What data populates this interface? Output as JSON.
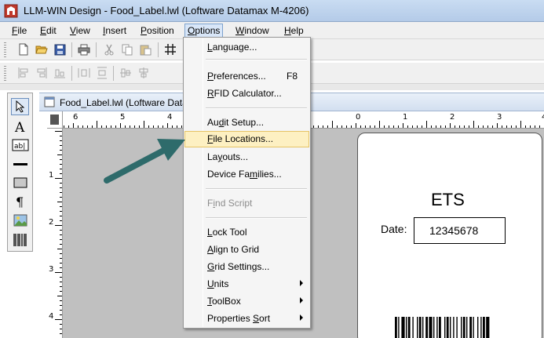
{
  "window": {
    "title": "LLM-WIN Design - Food_Label.lwl (Loftware Datamax M-4206)"
  },
  "menubar": {
    "items": [
      "File",
      "Edit",
      "View",
      "Insert",
      "Position",
      "Options",
      "Window",
      "Help"
    ],
    "active": "Options"
  },
  "document": {
    "title": "Food_Label.lwl (Loftware Data"
  },
  "ruler": {
    "horizontal": [
      "6",
      "5",
      "4",
      "0",
      "1",
      "2",
      "3",
      "4"
    ],
    "vertical": [
      "1",
      "2",
      "3",
      "4"
    ]
  },
  "options_menu": {
    "items": [
      {
        "label": "Language...",
        "mnemonic": "L"
      },
      {
        "label": "Preferences...",
        "mnemonic": "P",
        "shortcut": "F8"
      },
      {
        "label": "RFID Calculator...",
        "mnemonic": "R"
      },
      {
        "label": "Audit Setup...",
        "mnemonic": "d"
      },
      {
        "label": "File Locations...",
        "mnemonic": "F",
        "highlighted": true
      },
      {
        "label": "Layouts...",
        "mnemonic": "y"
      },
      {
        "label": "Device Families...",
        "mnemonic": "m"
      },
      {
        "label": "Find Script",
        "mnemonic": "i",
        "disabled": true
      },
      {
        "label": "Lock Tool",
        "mnemonic": "L"
      },
      {
        "label": "Align to Grid",
        "mnemonic": "A"
      },
      {
        "label": "Grid Settings...",
        "mnemonic": "G"
      },
      {
        "label": "Units",
        "mnemonic": "U",
        "submenu": true
      },
      {
        "label": "ToolBox",
        "mnemonic": "T",
        "submenu": true
      },
      {
        "label": "Properties Sort",
        "mnemonic": "S",
        "submenu": true
      }
    ]
  },
  "label_preview": {
    "title": "ETS",
    "date_label": "Date:",
    "date_value": "12345678"
  },
  "colors": {
    "highlight_bg": "#fdf0c2",
    "highlight_border": "#e5c365",
    "annotation_arrow": "#2e6b6b"
  },
  "icons": {
    "app": "app-icon",
    "toolbar1": [
      "new-icon",
      "open-icon",
      "save-icon",
      "print-icon",
      "cut-icon",
      "copy-icon",
      "paste-icon",
      "grid-icon"
    ],
    "toolbar2": [
      "align-left-icon",
      "align-right-icon",
      "align-bottom-icon",
      "distribute-h-icon",
      "distribute-v-icon",
      "center-v-icon",
      "center-h-icon"
    ],
    "toolbox": [
      "pointer-icon",
      "text-icon",
      "data-field-icon",
      "line-icon",
      "rectangle-icon",
      "paragraph-icon",
      "image-icon",
      "barcode-icon"
    ]
  }
}
